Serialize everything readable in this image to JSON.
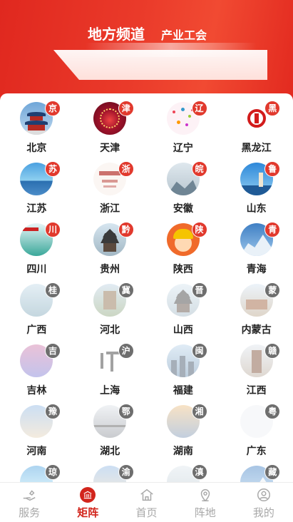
{
  "header": {
    "tabs": [
      {
        "label": "地方频道"
      },
      {
        "label": "产业工会"
      }
    ]
  },
  "colors": {
    "brand": "#e0281f",
    "badge_active": "#e1392d",
    "badge_inactive": "#6e6e6e",
    "nav_active": "#d2251c",
    "nav_inactive": "#a8a8a8"
  },
  "regions": [
    {
      "name": "北京",
      "abbr": "京",
      "active": true,
      "scene": "temple"
    },
    {
      "name": "天津",
      "abbr": "津",
      "active": true,
      "scene": "ferris"
    },
    {
      "name": "辽宁",
      "abbr": "辽",
      "active": true,
      "scene": "dots"
    },
    {
      "name": "黑龙江",
      "abbr": "黑",
      "active": true,
      "scene": "logo"
    },
    {
      "name": "江苏",
      "abbr": "苏",
      "active": true,
      "scene": "sea"
    },
    {
      "name": "浙江",
      "abbr": "浙",
      "active": true,
      "scene": "text"
    },
    {
      "name": "安徽",
      "abbr": "皖",
      "active": true,
      "scene": "mountain"
    },
    {
      "name": "山东",
      "abbr": "鲁",
      "active": true,
      "scene": "lighthouse"
    },
    {
      "name": "四川",
      "abbr": "川",
      "active": true,
      "scene": "green"
    },
    {
      "name": "贵州",
      "abbr": "黔",
      "active": true,
      "scene": "pagoda"
    },
    {
      "name": "陕西",
      "abbr": "陕",
      "active": true,
      "scene": "cartoon"
    },
    {
      "name": "青海",
      "abbr": "青",
      "active": true,
      "scene": "snowpeak"
    },
    {
      "name": "广西",
      "abbr": "桂",
      "active": false,
      "scene": "river"
    },
    {
      "name": "河北",
      "abbr": "冀",
      "active": false,
      "scene": "wall"
    },
    {
      "name": "山西",
      "abbr": "晋",
      "active": false,
      "scene": "pagoda"
    },
    {
      "name": "内蒙古",
      "abbr": "蒙",
      "active": false,
      "scene": "palace"
    },
    {
      "name": "吉林",
      "abbr": "吉",
      "active": false,
      "scene": "city"
    },
    {
      "name": "上海",
      "abbr": "沪",
      "active": false,
      "scene": "calligraphy"
    },
    {
      "name": "福建",
      "abbr": "闽",
      "active": false,
      "scene": "skyline"
    },
    {
      "name": "江西",
      "abbr": "赣",
      "active": false,
      "scene": "tower"
    },
    {
      "name": "河南",
      "abbr": "豫",
      "active": false,
      "scene": "citysky"
    },
    {
      "name": "湖北",
      "abbr": "鄂",
      "active": false,
      "scene": "bridge"
    },
    {
      "name": "湖南",
      "abbr": "湘",
      "active": false,
      "scene": "sunset"
    },
    {
      "name": "广东",
      "abbr": "粤",
      "active": false,
      "scene": "blank"
    },
    {
      "name": "",
      "abbr": "琼",
      "active": false,
      "scene": "sea"
    },
    {
      "name": "",
      "abbr": "渝",
      "active": false,
      "scene": "citysky"
    },
    {
      "name": "",
      "abbr": "滇",
      "active": false,
      "scene": "mountain"
    },
    {
      "name": "",
      "abbr": "藏",
      "active": false,
      "scene": "snowpeak"
    }
  ],
  "bottom_nav": [
    {
      "label": "服务",
      "icon": "hand-service-icon",
      "active": false
    },
    {
      "label": "矩阵",
      "icon": "bank-building-icon",
      "active": true
    },
    {
      "label": "首页",
      "icon": "home-icon",
      "active": false
    },
    {
      "label": "阵地",
      "icon": "location-pin-icon",
      "active": false
    },
    {
      "label": "我的",
      "icon": "user-profile-icon",
      "active": false
    }
  ]
}
